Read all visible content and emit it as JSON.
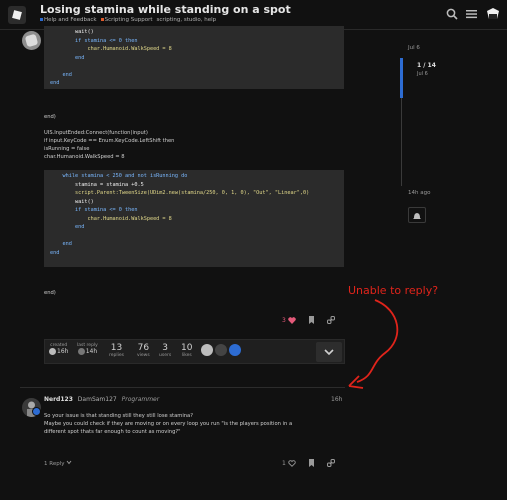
{
  "header": {
    "topic_title": "Losing stamina while standing on a spot",
    "categories": [
      {
        "label": "Help and Feedback",
        "color": "#2d6cd2"
      },
      {
        "label": "Scripting Support",
        "color": "#e05a2b"
      }
    ],
    "tags": "scripting, studio, help"
  },
  "post1": {
    "code1_lines": [
      "        wait()",
      "        if stamina <= 0 then",
      "            char.Humanoid.WalkSpeed = 8",
      "        end",
      "",
      "    end",
      "end"
    ],
    "text_lines": [
      "end)",
      "",
      "UIS.InputEnded:Connect(function(input)",
      "if input.KeyCode == Enum.KeyCode.LeftShift then",
      "isRunning = false",
      "char.Humanoid.WalkSpeed = 8"
    ],
    "code2_lines": [
      "    while stamina < 250 and not isRunning do",
      "        stamina = stamina +0.5",
      "        script.Parent:TweenSize(UDim2.new(stamina/250, 0, 1, 0), \"Out\", \"Linear\",0)",
      "        wait()",
      "        if stamina <= 0 then",
      "            char.Humanoid.WalkSpeed = 8",
      "        end",
      "",
      "    end",
      "end"
    ],
    "closing": "end)",
    "like_count": "3"
  },
  "topic_map": {
    "created_label": "created",
    "created_value": "16h",
    "last_reply_label": "last reply",
    "last_reply_value": "14h",
    "replies_value": "13",
    "replies_label": "replies",
    "views_value": "76",
    "views_label": "views",
    "users_value": "3",
    "users_label": "users",
    "likes_value": "10",
    "likes_label": "likes"
  },
  "post2": {
    "username": "Nerd123",
    "display_name": "DamSam127",
    "title": "Programmer",
    "time": "16h",
    "body_lines": [
      "So your issue is that standing still they still lose stamina?",
      "Maybe you could check if they are moving or on every loop you run \"is the players position in a",
      "different spot thats far enough to count as moving?\""
    ],
    "reply_count": "1 Reply",
    "like_count": "1"
  },
  "timeline": {
    "start_date": "Jul 6",
    "position": "1 / 14",
    "position_date": "Jul 6",
    "end_label": "14h ago"
  },
  "annotation": {
    "text": "Unable to reply?",
    "color": "#e0241b"
  },
  "colors": {
    "background": "#111111",
    "accent": "#2d6cd2",
    "like": "#e45a7a"
  }
}
